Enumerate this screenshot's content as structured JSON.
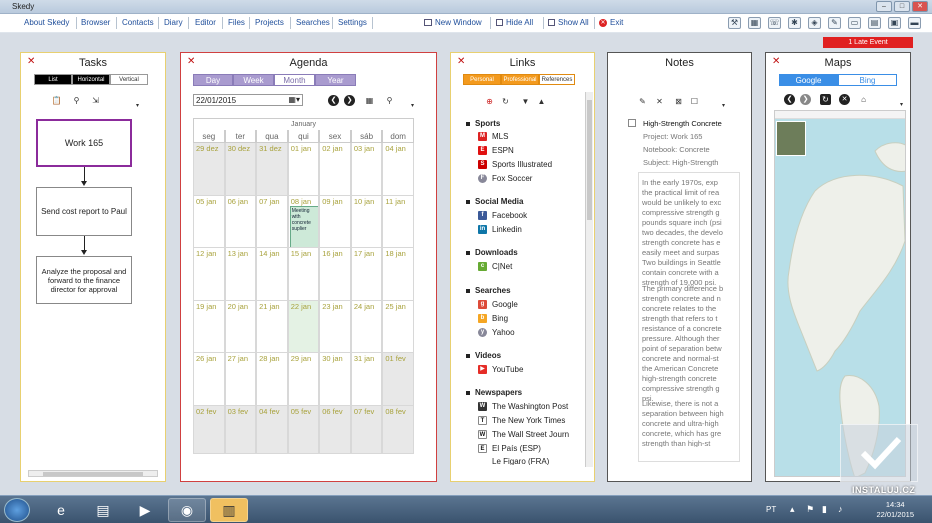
{
  "window": {
    "title": "Skedy"
  },
  "menu": {
    "items": [
      "About Skedy",
      "Browser",
      "Contacts",
      "Diary",
      "Editor",
      "Files",
      "Projects",
      "Searches",
      "Settings"
    ],
    "new_window": "New Window",
    "hide_all": "Hide All",
    "show_all": "Show All",
    "exit": "Exit"
  },
  "late_event": "1 Late Event",
  "tasks": {
    "title": "Tasks",
    "tabs": [
      "List",
      "Horizontal",
      "Vertical"
    ],
    "active_tab": "Vertical",
    "items": [
      "Work 165",
      "Send cost report to Paul",
      "Analyze the proposal and forward to the finance director for approval"
    ]
  },
  "agenda": {
    "title": "Agenda",
    "views": [
      "Day",
      "Week",
      "Month",
      "Year"
    ],
    "active_view": "Month",
    "date": "22/01/2015",
    "month_label": "January",
    "weekdays": [
      "seg",
      "ter",
      "qua",
      "qui",
      "sex",
      "sáb",
      "dom"
    ],
    "weeks": [
      [
        "29 dez",
        "30 dez",
        "31 dez",
        "01 jan",
        "02 jan",
        "03 jan",
        "04 jan"
      ],
      [
        "05 jan",
        "06 jan",
        "07 jan",
        "08 jan",
        "09 jan",
        "10 jan",
        "11 jan"
      ],
      [
        "12 jan",
        "13 jan",
        "14 jan",
        "15 jan",
        "16 jan",
        "17 jan",
        "18 jan"
      ],
      [
        "19 jan",
        "20 jan",
        "21 jan",
        "22 jan",
        "23 jan",
        "24 jan",
        "25 jan"
      ],
      [
        "26 jan",
        "27 jan",
        "28 jan",
        "29 jan",
        "30 jan",
        "31 jan",
        "01 fev"
      ],
      [
        "02 fev",
        "03 fev",
        "04 fev",
        "05 fev",
        "06 fev",
        "07 fev",
        "08 fev"
      ]
    ],
    "event": "Meeting with concrete suplier"
  },
  "links": {
    "title": "Links",
    "tabs": [
      "Personal",
      "Professional",
      "References"
    ],
    "active_tab": "Personal",
    "sections": [
      {
        "name": "Sports",
        "items": [
          "MLS",
          "ESPN",
          "Sports Illustrated",
          "Fox Soccer"
        ]
      },
      {
        "name": "Social Media",
        "items": [
          "Facebook",
          "Linkedin"
        ]
      },
      {
        "name": "Downloads",
        "items": [
          "C|Net"
        ]
      },
      {
        "name": "Searches",
        "items": [
          "Google",
          "Bing",
          "Yahoo"
        ]
      },
      {
        "name": "Videos",
        "items": [
          "YouTube"
        ]
      },
      {
        "name": "Newspapers",
        "items": [
          "The Washington Post",
          "The New York Times",
          "The Wall Street Journ",
          "El País (ESP)",
          "Le Figaro (FRA)"
        ]
      }
    ]
  },
  "notes": {
    "title": "Notes",
    "note_title": "High-Strength Concrete",
    "meta": [
      "Project: Work 165",
      "Notebook: Concrete",
      "Subject: High-Strength"
    ],
    "paragraphs": [
      [
        "In the early 1970s, exp",
        "the practical limit of rea",
        "would be unlikely to exc",
        "compressive strength g",
        "pounds square inch (psi",
        "two decades, the develo",
        "strength concrete has e",
        "easily meet and surpas",
        "Two buildings in Seattle",
        "contain concrete with a",
        "strength of 19,000 psi."
      ],
      [
        "The primary difference b",
        "strength concrete and n",
        "concrete relates to the",
        "strength that refers to t",
        "resistance of a concrete",
        "pressure. Although ther",
        "point of separation betw",
        "concrete and normal-st",
        "the American Concrete",
        "high-strength concrete",
        "compressive strength g",
        "psi."
      ],
      [
        "Likewise, there is not a",
        "separation between high",
        "concrete and ultra-high",
        "concrete, which has gre",
        "strength than high-st"
      ]
    ]
  },
  "maps": {
    "title": "Maps",
    "tabs": [
      "Google",
      "Bing"
    ],
    "active_tab": "Google"
  },
  "taskbar": {
    "lang": "PT",
    "time": "14:34",
    "date": "22/01/2015"
  },
  "watermark": "INSTALUJ.CZ"
}
